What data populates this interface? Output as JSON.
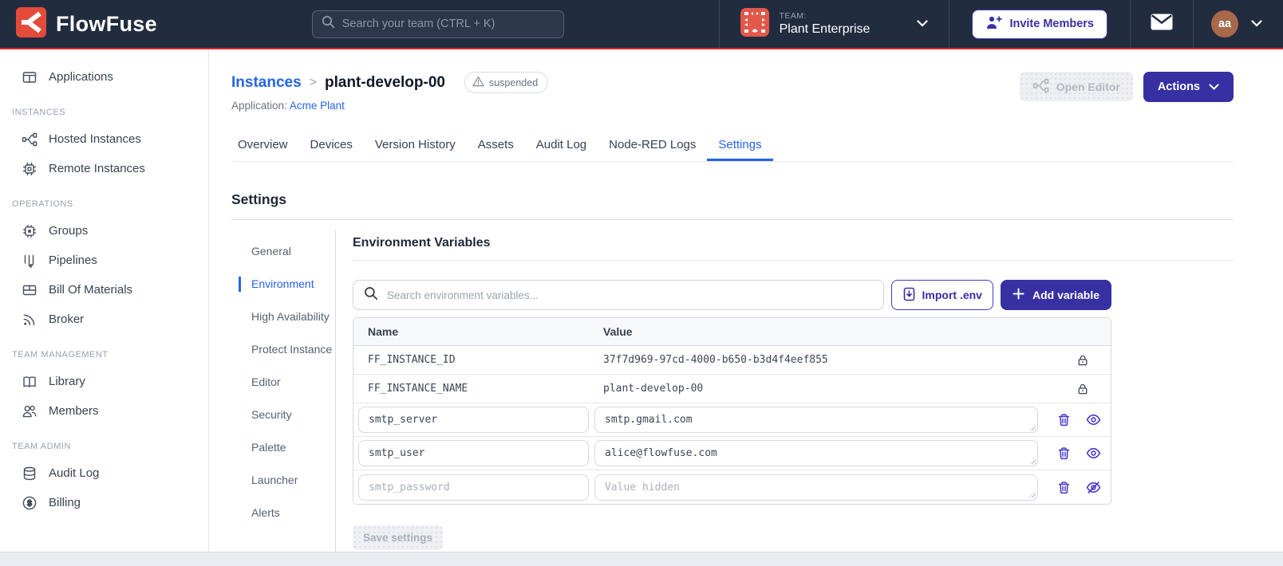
{
  "navbar": {
    "brand": "FlowFuse",
    "search_placeholder": "Search your team (CTRL + K)",
    "team_label": "TEAM:",
    "team_name": "Plant Enterprise",
    "invite_label": "Invite Members",
    "user_initials": "aa"
  },
  "sidebar": {
    "sections": [
      {
        "header": "",
        "items": [
          {
            "label": "Applications"
          }
        ]
      },
      {
        "header": "INSTANCES",
        "items": [
          {
            "label": "Hosted Instances"
          },
          {
            "label": "Remote Instances"
          }
        ]
      },
      {
        "header": "OPERATIONS",
        "items": [
          {
            "label": "Groups"
          },
          {
            "label": "Pipelines"
          },
          {
            "label": "Bill Of Materials"
          },
          {
            "label": "Broker"
          }
        ]
      },
      {
        "header": "TEAM MANAGEMENT",
        "items": [
          {
            "label": "Library"
          },
          {
            "label": "Members"
          }
        ]
      },
      {
        "header": "TEAM ADMIN",
        "items": [
          {
            "label": "Audit Log"
          },
          {
            "label": "Billing"
          }
        ]
      }
    ]
  },
  "page": {
    "breadcrumb_parent": "Instances",
    "breadcrumb_separator": ">",
    "instance_name": "plant-develop-00",
    "status_badge": "suspended",
    "application_label": "Application:",
    "application_name": "Acme Plant",
    "open_editor_label": "Open Editor",
    "actions_label": "Actions"
  },
  "tabs": {
    "items": [
      "Overview",
      "Devices",
      "Version History",
      "Assets",
      "Audit Log",
      "Node-RED Logs",
      "Settings"
    ],
    "active": "Settings"
  },
  "settings": {
    "title": "Settings",
    "nav": {
      "items": [
        "General",
        "Environment",
        "High Availability",
        "Protect Instance",
        "Editor",
        "Security",
        "Palette",
        "Launcher",
        "Alerts"
      ],
      "active": "Environment"
    }
  },
  "env": {
    "title": "Environment Variables",
    "search_placeholder": "Search environment variables...",
    "import_label": "Import .env",
    "add_label": "Add variable",
    "columns": {
      "name": "Name",
      "value": "Value"
    },
    "locked_rows": [
      {
        "name": "FF_INSTANCE_ID",
        "value": "37f7d969-97cd-4000-b650-b3d4f4eef855"
      },
      {
        "name": "FF_INSTANCE_NAME",
        "value": "plant-develop-00"
      }
    ],
    "editable_rows": [
      {
        "name": "smtp_server",
        "value": "smtp.gmail.com"
      },
      {
        "name": "smtp_user",
        "value": "alice@flowfuse.com"
      },
      {
        "name": "smtp_password",
        "value": "",
        "value_placeholder": "Value hidden"
      }
    ],
    "save_label": "Save settings"
  },
  "colors": {
    "navbar_bg": "#222c3f",
    "navbar_red_border": "#d8242f",
    "logo_red": "#e34b3b",
    "team_avatar_orange": "#e2584b",
    "user_avatar_brown": "#a8684a",
    "indigo_button": "#3730a3",
    "indigo_outline": "#4338ca",
    "link_blue": "#2563eb"
  }
}
